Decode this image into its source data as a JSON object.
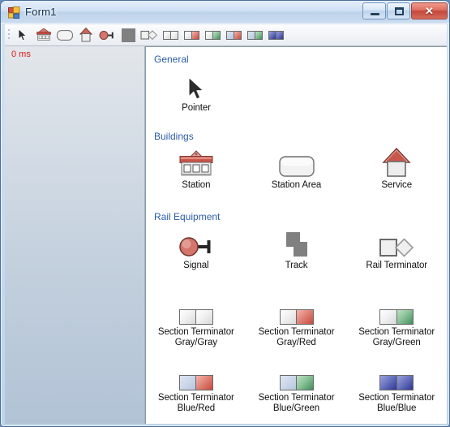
{
  "window": {
    "title": "Form1",
    "app_icon": "winforms-icon",
    "controls": {
      "minimize": "minimize-button",
      "maximize": "maximize-button",
      "close_label": "✕"
    }
  },
  "toolbar": {
    "items": [
      {
        "name": "pointer",
        "icon": "pointer-icon"
      },
      {
        "name": "station",
        "icon": "station-icon"
      },
      {
        "name": "station-area",
        "icon": "station-area-icon"
      },
      {
        "name": "service",
        "icon": "service-icon"
      },
      {
        "name": "signal",
        "icon": "signal-icon"
      },
      {
        "name": "track",
        "icon": "track-icon"
      },
      {
        "name": "rail-terminator",
        "icon": "rail-terminator-icon"
      },
      {
        "name": "section-terminator-gray-gray",
        "icon": "section-terminator-icon",
        "left": "#d9d9d9",
        "right": "#d9d9d9"
      },
      {
        "name": "section-terminator-gray-red",
        "icon": "section-terminator-icon",
        "left": "#d9d9d9",
        "right": "#c8493c"
      },
      {
        "name": "section-terminator-gray-green",
        "icon": "section-terminator-icon",
        "left": "#d9d9d9",
        "right": "#3f8f5b"
      },
      {
        "name": "section-terminator-blue-red",
        "icon": "section-terminator-icon",
        "left": "#b7c6de",
        "right": "#c8493c"
      },
      {
        "name": "section-terminator-blue-green",
        "icon": "section-terminator-icon",
        "left": "#b7c6de",
        "right": "#3f8f5b"
      },
      {
        "name": "section-terminator-blue-blue",
        "icon": "section-terminator-icon",
        "left": "#2e3590",
        "right": "#2e3590"
      }
    ]
  },
  "left_panel": {
    "timer_label": "0 ms",
    "timer_color": "#e01b1b"
  },
  "palette": {
    "groups": [
      {
        "title": "General",
        "items": [
          {
            "label": "Pointer",
            "icon": "pointer-icon"
          }
        ]
      },
      {
        "title": "Buildings",
        "items": [
          {
            "label": "Station",
            "icon": "station-icon"
          },
          {
            "label": "Station Area",
            "icon": "station-area-icon"
          },
          {
            "label": "Service",
            "icon": "service-icon"
          }
        ]
      },
      {
        "title": "Rail Equipment",
        "items": [
          {
            "label": "Signal",
            "icon": "signal-icon"
          },
          {
            "label": "Track",
            "icon": "track-icon"
          },
          {
            "label": "Rail Terminator",
            "icon": "rail-terminator-icon"
          },
          {
            "label": "Section Terminator\nGray/Gray",
            "line1": "Section Terminator",
            "line2": "Gray/Gray",
            "icon": "section-terminator-icon",
            "left": "gray",
            "right": "gray"
          },
          {
            "label": "Section Terminator\nGray/Red",
            "line1": "Section Terminator",
            "line2": "Gray/Red",
            "icon": "section-terminator-icon",
            "left": "gray",
            "right": "red"
          },
          {
            "label": "Section Terminator\nGray/Green",
            "line1": "Section Terminator",
            "line2": "Gray/Green",
            "icon": "section-terminator-icon",
            "left": "gray",
            "right": "green"
          },
          {
            "label": "Section Terminator\nBlue/Red",
            "line1": "Section Terminator",
            "line2": "Blue/Red",
            "icon": "section-terminator-icon",
            "left": "blue",
            "right": "red"
          },
          {
            "label": "Section Terminator\nBlue/Green",
            "line1": "Section Terminator",
            "line2": "Blue/Green",
            "icon": "section-terminator-icon",
            "left": "blue",
            "right": "green"
          },
          {
            "label": "Section Terminator\nBlue/Blue",
            "line1": "Section Terminator",
            "line2": "Blue/Blue",
            "icon": "section-terminator-icon",
            "left": "bluedk",
            "right": "bluedk"
          }
        ]
      }
    ]
  },
  "colors": {
    "group_title": "#2a5ca8",
    "accent_red": "#c8493c",
    "accent_green": "#3f8f5b",
    "accent_blue": "#2e3590",
    "gray": "#808080"
  }
}
